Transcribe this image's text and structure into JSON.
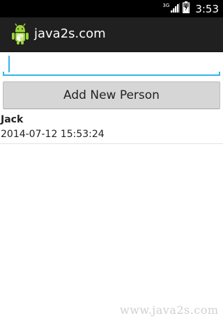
{
  "status_bar": {
    "network_type": "3G",
    "time": "3:53",
    "icons": [
      "signal-icon",
      "battery-icon"
    ]
  },
  "action_bar": {
    "title": "java2s.com",
    "icon": "android-icon"
  },
  "form": {
    "input_value": "",
    "add_button_label": "Add New Person"
  },
  "people": [
    {
      "name": "Jack",
      "date": "2014-07-12 15:53:24"
    }
  ],
  "watermark": "www.java2s.com",
  "colors": {
    "accent": "#33b5e5",
    "action_bar": "#202020",
    "status_bar": "#000000",
    "button": "#d6d6d6"
  }
}
